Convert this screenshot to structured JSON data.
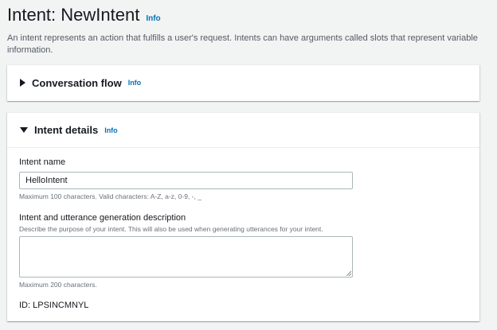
{
  "header": {
    "title": "Intent: NewIntent",
    "info_label": "Info",
    "description": "An intent represents an action that fulfills a user's request. Intents can have arguments called slots that represent variable information."
  },
  "conversation_flow": {
    "title": "Conversation flow",
    "info_label": "Info",
    "expanded": false
  },
  "intent_details": {
    "title": "Intent details",
    "info_label": "Info",
    "expanded": true,
    "intent_name": {
      "label": "Intent name",
      "value": "HelloIntent",
      "hint": "Maximum 100 characters. Valid characters: A-Z, a-z, 0-9, -, _"
    },
    "description_field": {
      "label": "Intent and utterance generation description",
      "sublabel": "Describe the purpose of your intent. This will also be used when generating utterances for your intent.",
      "value": "",
      "hint": "Maximum 200 characters."
    },
    "id_text": "ID: LPSINCMNYL"
  },
  "colors": {
    "background": "#f2f3f3",
    "link": "#0073bb",
    "text": "#16191f",
    "hint": "#687078",
    "border": "#aab7b8"
  }
}
